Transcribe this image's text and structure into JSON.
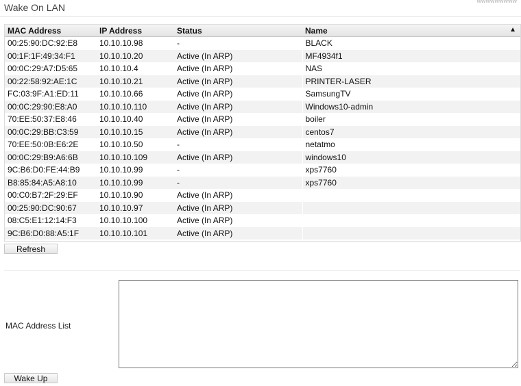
{
  "page": {
    "title": "Wake On LAN",
    "corner_text": "wwwwwwwww"
  },
  "table": {
    "columns": [
      "MAC Address",
      "IP Address",
      "Status",
      "Name"
    ],
    "sort_indicator": "▲",
    "rows": [
      [
        "00:25:90:DC:92:E8",
        "10.10.10.98",
        "-",
        "BLACK"
      ],
      [
        "00:1F:1F:49:34:F1",
        "10.10.10.20",
        "Active (In ARP)",
        "MF4934f1"
      ],
      [
        "00:0C:29:A7:D5:65",
        "10.10.10.4",
        "Active (In ARP)",
        "NAS"
      ],
      [
        "00:22:58:92:AE:1C",
        "10.10.10.21",
        "Active (In ARP)",
        "PRINTER-LASER"
      ],
      [
        "FC:03:9F:A1:ED:11",
        "10.10.10.66",
        "Active (In ARP)",
        "SamsungTV"
      ],
      [
        "00:0C:29:90:E8:A0",
        "10.10.10.110",
        "Active (In ARP)",
        "Windows10-admin"
      ],
      [
        "70:EE:50:37:E8:46",
        "10.10.10.40",
        "Active (In ARP)",
        "boiler"
      ],
      [
        "00:0C:29:BB:C3:59",
        "10.10.10.15",
        "Active (In ARP)",
        "centos7"
      ],
      [
        "70:EE:50:0B:E6:2E",
        "10.10.10.50",
        "-",
        "netatmo"
      ],
      [
        "00:0C:29:B9:A6:6B",
        "10.10.10.109",
        "Active (In ARP)",
        "windows10"
      ],
      [
        "9C:B6:D0:FE:44:B9",
        "10.10.10.99",
        "-",
        "xps7760"
      ],
      [
        "B8:85:84:A5:A8:10",
        "10.10.10.99",
        "-",
        "xps7760"
      ],
      [
        "00:C0:B7:2F:29:EF",
        "10.10.10.90",
        "Active (In ARP)",
        ""
      ],
      [
        "00:25:90:DC:90:67",
        "10.10.10.97",
        "Active (In ARP)",
        ""
      ],
      [
        "08:C5:E1:12:14:F3",
        "10.10.10.100",
        "Active (In ARP)",
        ""
      ],
      [
        "9C:B6:D0:88:A5:1F",
        "10.10.10.101",
        "Active (In ARP)",
        ""
      ]
    ]
  },
  "buttons": {
    "refresh": "Refresh",
    "wake_up": "Wake Up"
  },
  "mac_list": {
    "label": "MAC Address List",
    "value": ""
  }
}
